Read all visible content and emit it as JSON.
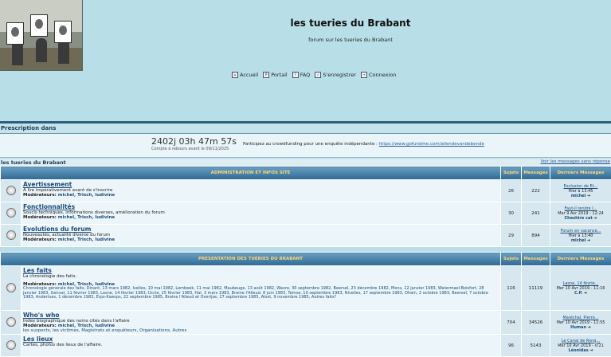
{
  "site": {
    "title": "les tueries du Brabant",
    "description": "forum sur les tueries du Brabant"
  },
  "nav": [
    {
      "label": "Accueil",
      "icon": "home-icon"
    },
    {
      "label": "Portail",
      "icon": "portal-icon"
    },
    {
      "label": "FAQ",
      "icon": "faq-icon"
    },
    {
      "label": "S'enregistrer",
      "icon": "register-icon"
    },
    {
      "label": "Connexion",
      "icon": "login-icon"
    }
  ],
  "prescription": {
    "title": "Prescription dans",
    "timer": "2402j 03h 47m 57s",
    "timer_sub": "Compte à rebours avant le 09/11/2025",
    "crowd_text": "Participez au crowdfunding pour une enquête indépendante :",
    "crowd_link": "https://www.gofundme.com/allendevandebende"
  },
  "breadcrumb": {
    "label": "les tueries du Brabant",
    "unread": "Voir les messages sans réponse"
  },
  "columns": {
    "sujets": "Sujets",
    "messages": "Messages",
    "derniers": "Derniers Messages"
  },
  "cat1": {
    "title": "ADMINISTRATION ET INFOS SITE",
    "forums": [
      {
        "name": "Avertissement",
        "desc": "A lire impérativement avant de s'inscrire",
        "mods_label": "Modérateurs:",
        "mods": "michel, Trisch, ludivine",
        "topics": "26",
        "posts": "222",
        "last_title": "Exclusion de Et...",
        "last_date": "Hier à 13:45",
        "last_user": "michel"
      },
      {
        "name": "Fonctionnalités",
        "desc": "Soucis techniques, informations diverses, amélioration du forum",
        "mods_label": "Modérateurs:",
        "mods": "michel, Trisch, ludivine",
        "topics": "30",
        "posts": "241",
        "last_title": "Faut-il rendre l...",
        "last_date": "Mar 9 Avr 2019 - 12:24",
        "last_user": "Cheshire cat"
      },
      {
        "name": "Evolutions du forum",
        "desc": "Nouveautés, actualité diverse du forum",
        "mods_label": "Modérateurs:",
        "mods": "michel, Trisch, ludivine",
        "topics": "29",
        "posts": "894",
        "last_title": "Forum en vacance...",
        "last_date": "Hier à 13:40",
        "last_user": "michel"
      }
    ]
  },
  "cat2": {
    "title": "PRESENTATION DES TUERIES DU BRABANT",
    "forums": [
      {
        "name": "Les faits",
        "desc": "La chronologie des faits.",
        "mods_label": "Modérateurs:",
        "mods": "michel, Trisch, ludivine",
        "subs": "Chronologie générale des faits, Dinant, 13 mars 1982, Ivelles, 10 mai 1982, Lembeek, 11 mai 1982, Maubeuge, 13 août 1982, Wavre, 30 septembre 1982, Beersel, 23 décembre 1982, Mons, 12 janvier 1983, Watermael-Boisfort, 28 janvier 1983, Genval, 11 février 1983, Lasne, 14 février 1983, Uccle, 25 février 1983, Hal, 3 mars 1983, Braine l'Alleud, 8 juin 1983, Temse, 10 septembre 1983, Nivelles, 17 septembre 1983, Ohain, 2 octobre 1983, Beersel, 7 octobre 1983, Anderlues, 1 décembre 1983, Erps-Kwerps, 22 septembre 1985, Braine l'Alleud et Overijse, 27 septembre 1985, Alost, 9 novembre 1985, Autres faits?",
        "topics": "116",
        "posts": "11119",
        "last_title": "Lasne, 14 févrie...",
        "last_date": "Mer 10 Avr 2019 - 11:16",
        "last_user": "C.P."
      },
      {
        "name": "Who's who",
        "desc": "Index biographique des noms cités dans l'affaire",
        "mods_label": "Modérateurs:",
        "mods": "michel, Trisch, ludivine",
        "subs": "les suspects, les victimes, Magistrats et enquêteurs, Organisations, Autres",
        "topics": "704",
        "posts": "34526",
        "last_title": "Maréchal, Pierre...",
        "last_date": "Mer 10 Avr 2019 - 11:55",
        "last_user": "Human"
      },
      {
        "name": "Les lieux",
        "desc": "Cartes, photos des lieux de l'affaire.",
        "mods_label": "",
        "mods": "",
        "subs": "",
        "topics": "96",
        "posts": "5143",
        "last_title": "Le Canal de Ronq...",
        "last_date": "Mer 10 Avr 2019 - 0:21",
        "last_user": "Léonidas"
      }
    ]
  }
}
